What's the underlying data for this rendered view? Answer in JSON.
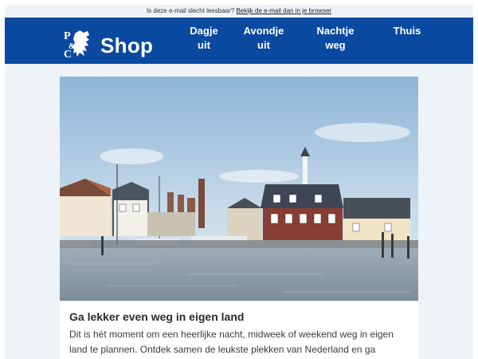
{
  "preheader": {
    "text": "Is deze e-mail slecht leesbaar?",
    "link": "Bekijk de e-mail dan in je browser"
  },
  "header": {
    "brand": "Shop",
    "bg_color": "#0a49a0",
    "nav": [
      {
        "label_1": "Dagje",
        "label_2": "uit"
      },
      {
        "label_1": "Avondje",
        "label_2": "uit"
      },
      {
        "label_1": "Nachtje",
        "label_2": "weg"
      },
      {
        "label_1": "Thuis",
        "label_2": ""
      }
    ]
  },
  "article": {
    "headline": "Ga lekker even weg in eigen land",
    "body": "Dit is hét moment om een heerlijke nacht, midweek of weekend weg in eigen land te plannen. Ontdek samen de leukste plekken van Nederland en ga"
  }
}
